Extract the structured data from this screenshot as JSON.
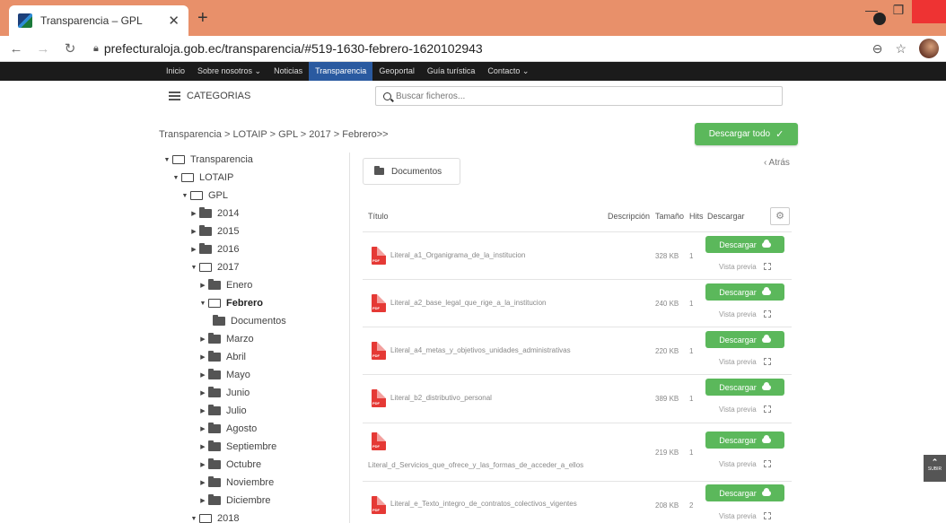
{
  "browser": {
    "tab_title": "Transparencia – GPL",
    "url": "prefecturaloja.gob.ec/transparencia/#519-1630-febrero-1620102943"
  },
  "nav": {
    "items": [
      "Inicio",
      "Sobre nosotros ⌄",
      "Noticias",
      "Transparencia",
      "Geoportal",
      "Guía turística",
      "Contacto ⌄"
    ],
    "active": "Transparencia"
  },
  "categories_label": "CATEGORIAS",
  "search": {
    "placeholder": "Buscar ficheros..."
  },
  "breadcrumb": "Transparencia  >  LOTAIP  >  GPL  >  2017  >  Febrero>>",
  "download_all_label": "Descargar todo",
  "tree": {
    "transparencia": "Transparencia",
    "lotaip": "LOTAIP",
    "gpl": "GPL",
    "y2014": "2014",
    "y2015": "2015",
    "y2016": "2016",
    "y2017": "2017",
    "enero": "Enero",
    "febrero": "Febrero",
    "documentos": "Documentos",
    "marzo": "Marzo",
    "abril": "Abril",
    "mayo": "Mayo",
    "junio": "Junio",
    "julio": "Julio",
    "agosto": "Agosto",
    "septiembre": "Septiembre",
    "octubre": "Octubre",
    "noviembre": "Noviembre",
    "diciembre": "Diciembre",
    "y2018": "2018"
  },
  "folder_box_label": "Documentos",
  "back_label": "‹ Atrás",
  "table_headers": {
    "title": "Título",
    "description": "Descripción",
    "size": "Tamaño",
    "hits": "Hits",
    "download": "Descargar"
  },
  "files": [
    {
      "name": "Literal_a1_Organigrama_de_la_institucion",
      "size": "328 KB",
      "hits": "1"
    },
    {
      "name": "Literal_a2_base_legal_que_rige_a_la_institucion",
      "size": "240 KB",
      "hits": "1"
    },
    {
      "name": "Literal_a4_metas_y_objetivos_unidades_administrativas",
      "size": "220 KB",
      "hits": "1"
    },
    {
      "name": "Literal_b2_distributivo_personal",
      "size": "389 KB",
      "hits": "1"
    },
    {
      "name": "Literal_d_Servicios_que_ofrece_y_las_formas_de_acceder_a_ellos",
      "size": "219 KB",
      "hits": "1"
    },
    {
      "name": "Literal_e_Texto_integro_de_contratos_colectivos_vigentes",
      "size": "208 KB",
      "hits": "2"
    }
  ],
  "file_actions": {
    "download": "Descargar",
    "preview": "Vista previa"
  },
  "pdf_label": "PDF",
  "scroll_top_label": "SUBIR"
}
